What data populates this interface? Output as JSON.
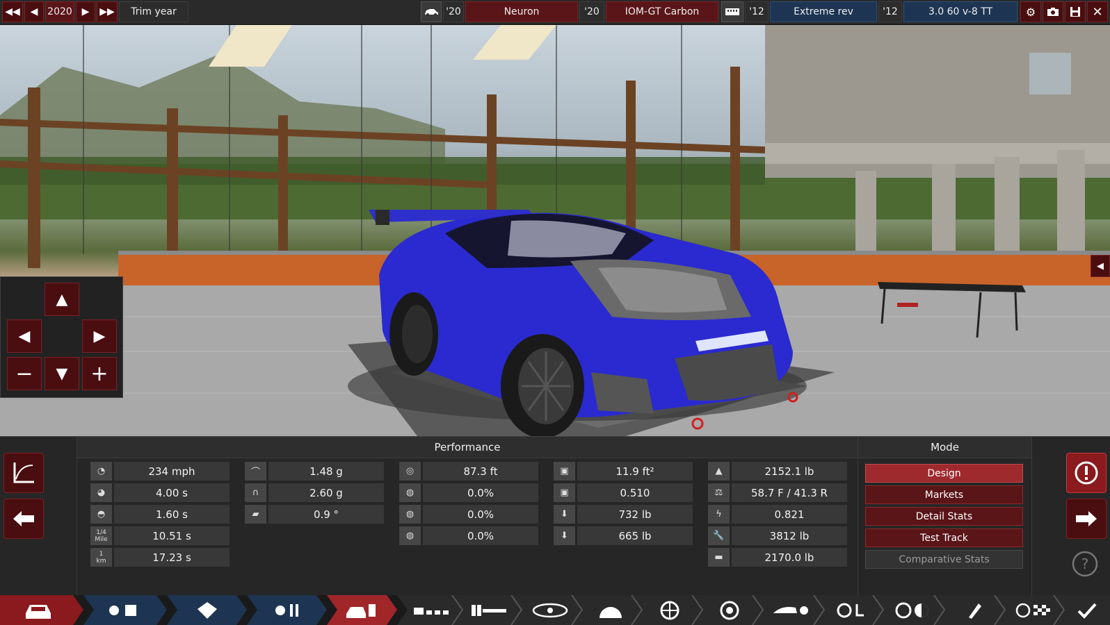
{
  "topbar": {
    "year": "2020",
    "trim_year_label": "Trim year",
    "body_year": "'20",
    "body_name": "Neuron",
    "variant_year": "'20",
    "variant_name": "IOM-GT Carbon",
    "engine_family_year": "'12",
    "engine_family_name": "Extreme rev",
    "engine_year": "'12",
    "engine_name": "3.0 60 v-8 TT"
  },
  "panel": {
    "performance_title": "Performance",
    "mode_title": "Mode",
    "stats": {
      "top_speed": "234 mph",
      "accel_0_60": "4.00 s",
      "accel_0_30": "1.60 s",
      "quarter_mile_label_top": "1/4",
      "quarter_mile_label_bottom": "Mile",
      "quarter_mile": "10.51 s",
      "km_label_top": "1",
      "km_label_bottom": "km",
      "one_km": "17.23 s",
      "cornering_low": "1.48 g",
      "cornering_high": "2.60 g",
      "body_roll": "0.9 °",
      "braking_distance": "87.3 ft",
      "brake_fade_1": "0.0%",
      "brake_fade_2": "0.0%",
      "brake_fade_3": "0.0%",
      "frontal_area": "11.9 ft²",
      "drag_coefficient": "0.510",
      "downforce_front": "732 lb",
      "downforce_rear": "665 lb",
      "weight": "2152.1 lb",
      "weight_distribution": "58.7 F / 41.3 R",
      "aero_ratio": "0.821",
      "tow_weight": "3812 lb",
      "cargo_weight": "2170.0 lb"
    },
    "modes": [
      "Design",
      "Markets",
      "Detail Stats",
      "Test Track",
      "Comparative Stats"
    ]
  },
  "colors": {
    "accent_red": "#5a1518",
    "active_red": "#9e2a2e",
    "car_blue": "#2a2ad0",
    "nav_blue": "#1d3552"
  }
}
